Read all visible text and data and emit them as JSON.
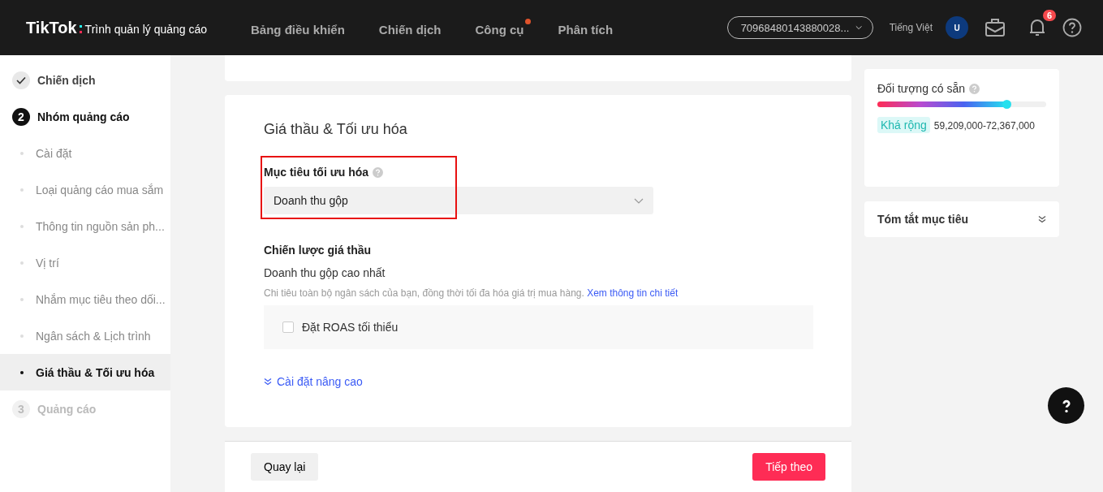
{
  "header": {
    "logo": "TikTok",
    "product": "Trình quản lý quảng cáo",
    "nav": [
      {
        "label": "Bảng điều khiển",
        "dot": false
      },
      {
        "label": "Chiến dịch",
        "dot": false
      },
      {
        "label": "Công cụ",
        "dot": true
      },
      {
        "label": "Phân tích",
        "dot": false
      }
    ],
    "account": "70968480143880028...",
    "language": "Tiếng Việt",
    "avatar": "U",
    "notifications": "6"
  },
  "sidebar": {
    "steps": [
      {
        "kind": "done",
        "label": "Chiến dịch"
      },
      {
        "kind": "active",
        "marker": "2",
        "label": "Nhóm quảng cáo",
        "children": [
          {
            "label": "Cài đặt",
            "selected": false
          },
          {
            "label": "Loại quảng cáo mua sắm",
            "selected": false
          },
          {
            "label": "Thông tin nguồn sản ph...",
            "selected": false
          },
          {
            "label": "Vị trí",
            "selected": false
          },
          {
            "label": "Nhắm mục tiêu theo dối...",
            "selected": false
          },
          {
            "label": "Ngân sách & Lịch trình",
            "selected": false
          },
          {
            "label": "Giá thầu & Tối ưu hóa",
            "selected": true
          }
        ]
      },
      {
        "kind": "pending",
        "marker": "3",
        "label": "Quảng cáo"
      }
    ]
  },
  "section": {
    "title": "Giá thầu & Tối ưu hóa",
    "goal": {
      "label": "Mục tiêu tối ưu hóa",
      "value": "Doanh thu gộp",
      "highlighted": true
    },
    "strategy": {
      "label": "Chiến lược giá thầu",
      "value": "Doanh thu gộp cao nhất",
      "description": "Chi tiêu toàn bộ ngân sách của bạn, đồng thời tối đa hóa giá trị mua hàng.",
      "link": "Xem thông tin chi tiết"
    },
    "roas": {
      "label": "Đặt ROAS tối thiểu",
      "checked": false
    },
    "advanced": "Cài đặt nâng cao"
  },
  "footer": {
    "back": "Quay lại",
    "next": "Tiếp theo"
  },
  "audience": {
    "title": "Đối tượng có sẵn",
    "level": 0.77,
    "tag": "Khá rộng",
    "range": "59,209,000-72,367,000"
  },
  "summary": {
    "title": "Tóm tắt mục tiêu"
  }
}
